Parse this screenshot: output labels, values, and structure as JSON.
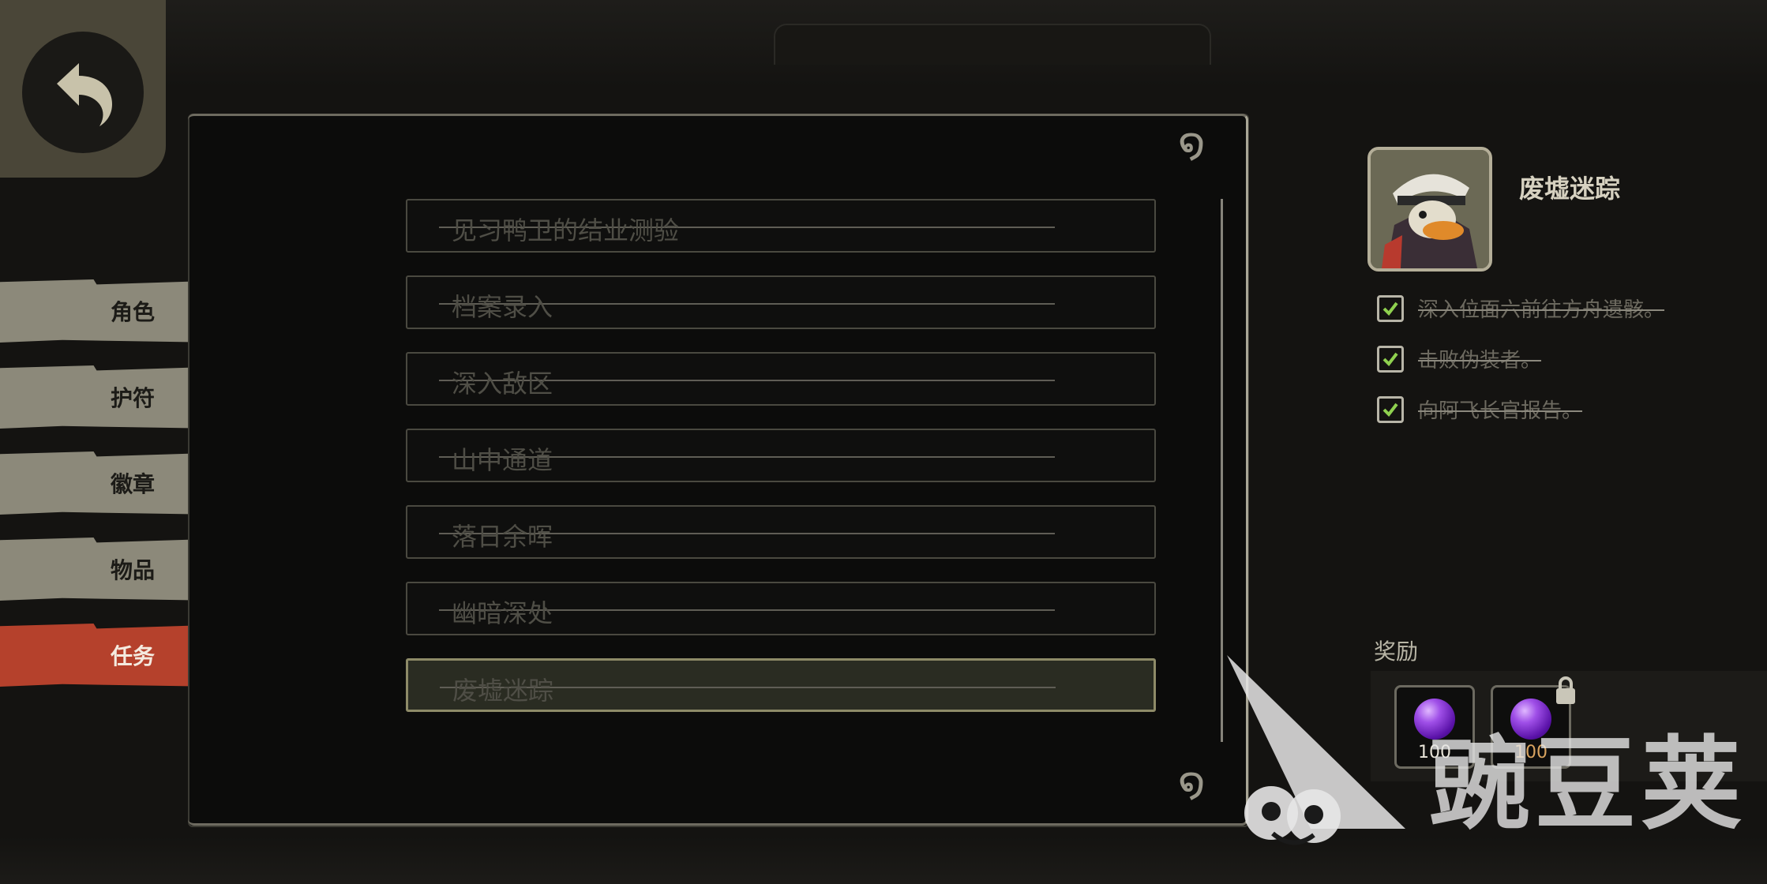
{
  "tabs": [
    {
      "label": "角色",
      "active": false
    },
    {
      "label": "护符",
      "active": false
    },
    {
      "label": "徽章",
      "active": false
    },
    {
      "label": "物品",
      "active": false
    },
    {
      "label": "任务",
      "active": true
    }
  ],
  "quests": [
    {
      "title": "见习鸭卫的结业测验",
      "completed": true
    },
    {
      "title": "档案录入",
      "completed": true
    },
    {
      "title": "深入敌区",
      "completed": true
    },
    {
      "title": "山中通道",
      "completed": true
    },
    {
      "title": "落日余晖",
      "completed": true
    },
    {
      "title": "幽暗深处",
      "completed": true
    },
    {
      "title": "废墟迷踪",
      "completed": true,
      "selected": true
    }
  ],
  "detail": {
    "title": "废墟迷踪",
    "objectives": [
      {
        "text": "深入位面六前往方舟遗骸。",
        "done": true
      },
      {
        "text": "击败伪装者。",
        "done": true
      },
      {
        "text": "向阿飞长官报告。",
        "done": true
      }
    ],
    "reward_label": "奖励",
    "rewards": [
      {
        "icon": "purple-orb-icon",
        "count": "100",
        "locked": false
      },
      {
        "icon": "purple-orb-icon",
        "count": "100",
        "locked": true
      }
    ]
  },
  "watermark": "豌豆荚",
  "colors": {
    "active_tab": "#b5412c",
    "tab": "#8c897a",
    "accent_check": "#8fd14f",
    "orb": "#a050e8"
  }
}
